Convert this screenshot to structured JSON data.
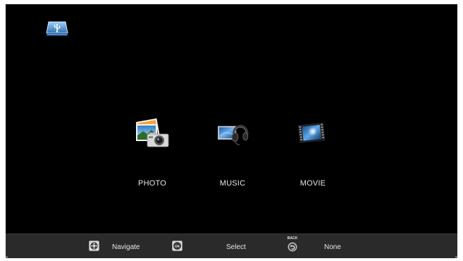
{
  "menu": {
    "items": [
      {
        "label": "PHOTO"
      },
      {
        "label": "MUSIC"
      },
      {
        "label": "MOVIE"
      }
    ]
  },
  "footer": {
    "navigate": "Navigate",
    "select": "Select",
    "back_tag": "BACK",
    "back_value": "None",
    "ok_tag": "OK"
  },
  "colors": {
    "screen_bg": "#000000",
    "footer_bg": "#2a2a2a",
    "text": "#e6e6e6",
    "usb_blue": "#3f86c8"
  },
  "icons": [
    "usb-drive-icon",
    "photo-icon",
    "music-icon",
    "movie-icon",
    "navigate-dpad-icon",
    "ok-button-icon",
    "back-button-icon"
  ]
}
